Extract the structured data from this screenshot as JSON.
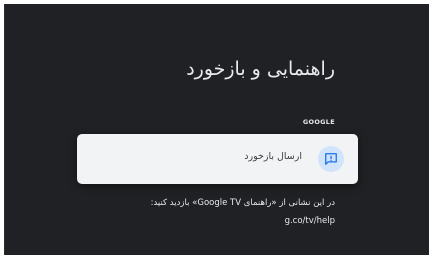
{
  "page": {
    "title": "راهنمایی و بازخورد",
    "section_label": "GOOGLE"
  },
  "feedback_card": {
    "label": "ارسال بازخورد",
    "icon": "feedback-icon"
  },
  "help": {
    "text": "در این نشانی از «راهنمای Google TV» بازدید کنید:",
    "link": "g.co/tv/help"
  },
  "colors": {
    "screen_background": "#202124",
    "card_background": "#f1f3f4",
    "icon_circle": "#d2e3fc",
    "icon_glyph": "#1a73e8",
    "text_primary": "#e8eaed"
  }
}
